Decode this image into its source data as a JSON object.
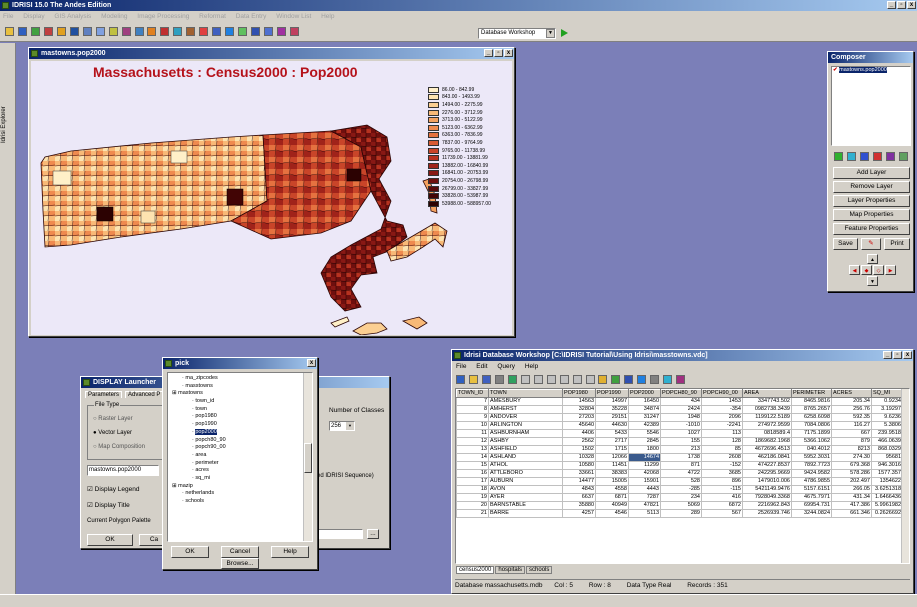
{
  "app": {
    "title": "IDRISI 15.0   The Andes Edition",
    "menu": [
      "File",
      "Display",
      "GIS Analysis",
      "Modeling",
      "Image Processing",
      "Reformat",
      "Data Entry",
      "Window List",
      "Help"
    ],
    "toolbar_select": "Database Workshop",
    "side_tab": "Idrisi Explorer"
  },
  "map_window": {
    "title": "mastowns.pop2000",
    "map_title": "Massachusetts : Census2000 : Pop2000",
    "legend": [
      {
        "label": "86.00 - 842.99",
        "color": "#fff0c8"
      },
      {
        "label": "843.00 - 1493.99",
        "color": "#fde3b0"
      },
      {
        "label": "1494.00 - 2275.99",
        "color": "#fbcf92"
      },
      {
        "label": "2276.00 - 3712.99",
        "color": "#f8b977"
      },
      {
        "label": "3713.00 - 5122.99",
        "color": "#f4a261"
      },
      {
        "label": "5123.00 - 6362.99",
        "color": "#ef8a4f"
      },
      {
        "label": "6363.00 - 7836.99",
        "color": "#e57240"
      },
      {
        "label": "7837.00 - 9764.99",
        "color": "#d95b33"
      },
      {
        "label": "9765.00 - 11738.99",
        "color": "#c94529"
      },
      {
        "label": "11739.00 - 13881.99",
        "color": "#b73220"
      },
      {
        "label": "13882.00 - 16840.99",
        "color": "#a0231a"
      },
      {
        "label": "16841.00 - 20753.99",
        "color": "#881814"
      },
      {
        "label": "20754.00 - 26798.99",
        "color": "#6f0f0e"
      },
      {
        "label": "26799.00 - 33827.99",
        "color": "#580909"
      },
      {
        "label": "33828.00 - 53987.99",
        "color": "#420505"
      },
      {
        "label": "53988.00 - 588957.00",
        "color": "#2c0202"
      }
    ]
  },
  "composer": {
    "title": "Composer",
    "layer": "mastowns.pop2000",
    "buttons": {
      "add_layer": "Add Layer",
      "remove_layer": "Remove Layer",
      "layer_properties": "Layer Properties",
      "map_properties": "Map Properties",
      "feature_properties": "Feature Properties",
      "save": "Save",
      "print": "Print"
    }
  },
  "display_launcher": {
    "title": "DISPLAY Launcher",
    "tabs": [
      "Parameters",
      "Advanced P"
    ],
    "file_type_label": "File Type",
    "file_types": [
      "Raster Layer",
      "Vector Layer",
      "Map Composition"
    ],
    "file_value": "mastowns.pop2000",
    "display_legend": "Display Legend",
    "display_title": "Display Title",
    "palette_label": "Current Polygon Palette",
    "num_classes_label": "Number of Classes",
    "num_classes_value": "256",
    "sequence_label": "ed IDRISI Sequence)",
    "ok": "OK",
    "cancel_partial": "Ca"
  },
  "pick": {
    "title": "pick",
    "items": [
      {
        "label": "ma_zipcodes",
        "indent": 1,
        "selected": false
      },
      {
        "label": "masstowns",
        "indent": 1,
        "selected": false
      },
      {
        "label": "mastowns",
        "indent": 0,
        "selected": false
      },
      {
        "label": "town_id",
        "indent": 2,
        "selected": false
      },
      {
        "label": "town",
        "indent": 2,
        "selected": false
      },
      {
        "label": "pop1980",
        "indent": 2,
        "selected": false
      },
      {
        "label": "pop1990",
        "indent": 2,
        "selected": false
      },
      {
        "label": "pop2000",
        "indent": 2,
        "selected": true
      },
      {
        "label": "popch80_90",
        "indent": 2,
        "selected": false
      },
      {
        "label": "popch90_00",
        "indent": 2,
        "selected": false
      },
      {
        "label": "area",
        "indent": 2,
        "selected": false
      },
      {
        "label": "perimeter",
        "indent": 2,
        "selected": false
      },
      {
        "label": "acres",
        "indent": 2,
        "selected": false
      },
      {
        "label": "sq_mi",
        "indent": 2,
        "selected": false
      },
      {
        "label": "mazip",
        "indent": 0,
        "selected": false
      },
      {
        "label": "netherlands",
        "indent": 1,
        "selected": false
      },
      {
        "label": "schools",
        "indent": 1,
        "selected": false
      }
    ],
    "ok": "OK",
    "cancel": "Cancel",
    "help": "Help",
    "browse": "Browse..."
  },
  "db_workshop": {
    "title": "Idrisi Database Workshop [C:\\IDRISI Tutorial\\Using Idrisi\\masstowns.vdc]",
    "menu": [
      "File",
      "Edit",
      "Query",
      "Help"
    ],
    "columns": [
      "TOWN_ID",
      "TOWN",
      "POP1980",
      "POP1990",
      "POP2000",
      "POPCH80_90",
      "POPCH90_00",
      "AREA",
      "PERIMETER",
      "ACRES",
      "SQ_MI"
    ],
    "rows": [
      [
        "7",
        "AMESBURY",
        "14563",
        "14997",
        "16450",
        "434",
        "1453",
        "3347743.502",
        "8465.9816",
        "205.34",
        "0.9234"
      ],
      [
        "8",
        "AMHERST",
        "32804",
        "35228",
        "34874",
        "2424",
        "-354",
        "0982738.3439",
        "8765.2657",
        "256.76",
        "3.19297"
      ],
      [
        "9",
        "ANDOVER",
        "27203",
        "29151",
        "31247",
        "1948",
        "2096",
        "1199122.5189",
        "6258.6098",
        "592.35",
        "9.6236"
      ],
      [
        "10",
        "ARLINGTON",
        "45640",
        "44630",
        "42389",
        "-1010",
        "-2241",
        "274972.9599",
        "7084.0806",
        "116.27",
        "5.3806"
      ],
      [
        "11",
        "ASHBURNHAM",
        "4406",
        "5433",
        "5546",
        "1027",
        "113",
        "0818589.4",
        "7175.1899",
        "667",
        "239.9518"
      ],
      [
        "12",
        "ASHBY",
        "2562",
        "2717",
        "2845",
        "155",
        "128",
        "1869682.1968",
        "5366.1062",
        "879",
        "466.0639"
      ],
      [
        "13",
        "ASHFIELD",
        "1502",
        "1715",
        "1800",
        "213",
        "85",
        "4672696.4513",
        "040.4012",
        "8213",
        "868.0329"
      ],
      [
        "14",
        "ASHLAND",
        "10328",
        "12066",
        "14674",
        "1738",
        "2608",
        "462186.0841",
        "5952.3031",
        "274.30",
        "95681"
      ],
      [
        "15",
        "ATHOL",
        "10580",
        "11451",
        "11299",
        "871",
        "-152",
        "474227.8537",
        "7892.7723",
        "679.368",
        "946.3016"
      ],
      [
        "16",
        "ATTLEBORO",
        "33661",
        "38383",
        "42068",
        "4722",
        "3685",
        "242295.9669",
        "9424.9582",
        "578.286",
        "1577.357"
      ],
      [
        "17",
        "AUBURN",
        "14477",
        "15005",
        "15901",
        "528",
        "896",
        "1479010.006",
        "4786.9855",
        "202.497",
        "1354622"
      ],
      [
        "18",
        "AVON",
        "4843",
        "4558",
        "4443",
        "-285",
        "-115",
        "5421149.9476",
        "5157.6151",
        "266.05",
        "3.6251318"
      ],
      [
        "19",
        "AYER",
        "6637",
        "6871",
        "7287",
        "234",
        "416",
        "7928049.3368",
        "4675.7971",
        "431.34",
        "1.6466436"
      ],
      [
        "20",
        "BARNSTABLE",
        "35880",
        "40949",
        "47821",
        "5069",
        "6872",
        "2216962.843",
        "69954.731",
        "417.386",
        "5.9961982"
      ],
      [
        "21",
        "BARRE",
        "4257",
        "4546",
        "5113",
        "289",
        "567",
        "2526939.746",
        "3244.0824",
        "661.346",
        "0.2626692"
      ]
    ],
    "highlight": {
      "row": 7,
      "col": 4
    },
    "sheet_tabs": [
      "census2000",
      "hospitals",
      "schools"
    ],
    "status": {
      "database": "Database   massachusetts.mdb",
      "col": "Col : 5",
      "row": "Row : 8",
      "data_type": "Data Type  Real",
      "records": "Records : 351"
    },
    "first_col_width_hint": "TOWN_ID"
  },
  "colors": {
    "desktop": "#7b7fb8",
    "titlebar_active": "#0a246a",
    "map_bg": "#ece8f8",
    "map_title": "#b5121b",
    "cell_highlight": "#3a5a8c"
  }
}
